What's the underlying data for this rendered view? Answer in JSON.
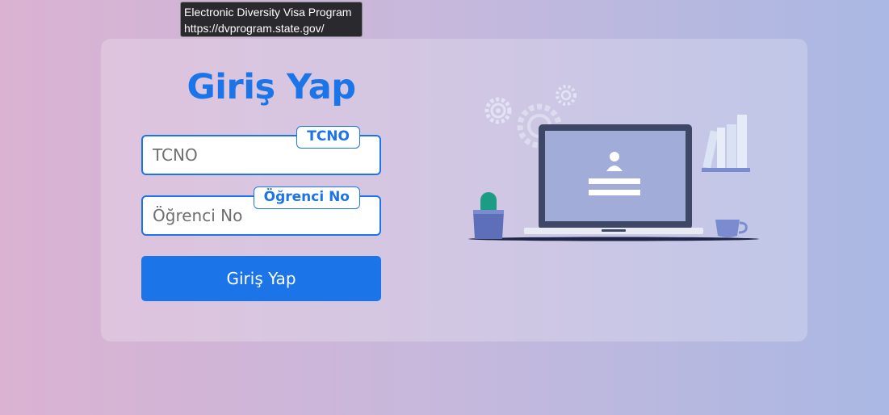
{
  "tooltip": {
    "title": "Electronic Diversity Visa Program",
    "url": "https://dvprogram.state.gov/"
  },
  "login": {
    "title": "Giriş Yap",
    "tcno": {
      "tag": "TCNO",
      "placeholder": "TCNO",
      "value": ""
    },
    "student_no": {
      "tag": "Öğrenci No",
      "placeholder": "Öğrenci No",
      "value": ""
    },
    "submit_label": "Giriş Yap"
  },
  "colors": {
    "accent": "#1b74e8",
    "background_left": "#dbb2d2",
    "background_right": "#aab8e3",
    "laptop_frame": "#3f4766",
    "laptop_screen": "#a1acd8"
  },
  "illustration": {
    "icons": [
      "gear-icon",
      "laptop-icon",
      "user-icon",
      "cactus-icon",
      "books-icon",
      "cup-icon"
    ]
  }
}
